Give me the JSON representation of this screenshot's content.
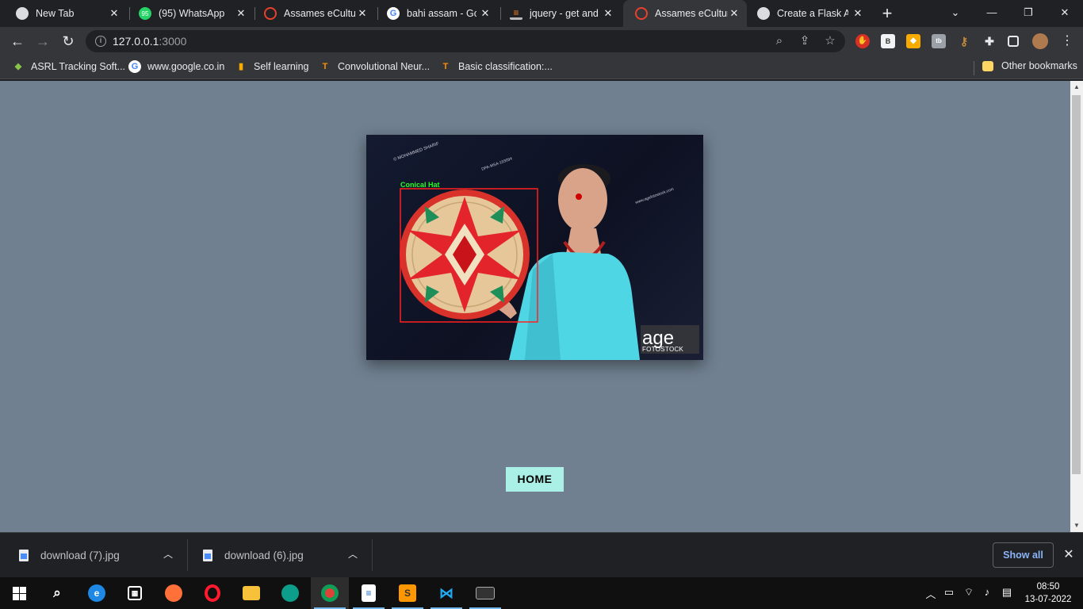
{
  "tabs": [
    {
      "title": "New Tab",
      "icon": "chrome-icon",
      "color": "#dadce0"
    },
    {
      "title": "(95) WhatsApp",
      "icon": "whatsapp-icon",
      "color": "#25d366",
      "badge": "95"
    },
    {
      "title": "Assames eCulture",
      "icon": "opera-icon",
      "color": "#e8412c"
    },
    {
      "title": "bahi assam - Google",
      "icon": "google-icon",
      "color": "#4285f4"
    },
    {
      "title": "jquery - get and l",
      "icon": "stackoverflow-icon",
      "color": "#f48024"
    },
    {
      "title": "Assames eCulture",
      "icon": "opera-icon",
      "color": "#e8412c"
    },
    {
      "title": "Create a Flask App",
      "icon": "flask-icon",
      "color": "#dadce0"
    }
  ],
  "active_tab": 5,
  "window": {
    "minimize": "—",
    "restore": "❐",
    "close": "✕",
    "newtab": "+",
    "tabsearch": "⌄"
  },
  "address": {
    "host": "127.0.0.1",
    "port": ":3000"
  },
  "bookmarks": [
    {
      "label": "ASRL Tracking Soft...",
      "icon": "asrl-icon",
      "color": "#8bc34a"
    },
    {
      "label": "www.google.co.in",
      "icon": "google-icon",
      "color": "#4285f4"
    },
    {
      "label": "Self learning",
      "icon": "analytics-icon",
      "color": "#f9ab00"
    },
    {
      "label": "Convolutional Neur...",
      "icon": "tensorflow-icon",
      "color": "#ff8f00"
    },
    {
      "label": "Basic classification:...",
      "icon": "tensorflow-icon",
      "color": "#ff8f00"
    }
  ],
  "other_bookmarks": "Other bookmarks",
  "photo": {
    "detection_label": "Conical Hat",
    "detection_color": "#ff2020",
    "label_color": "#22ff22",
    "watermark_brand": "age",
    "watermark_sub": "FOTOSTOCK",
    "watermark_credit": "© MOHAMMED SHARIF",
    "watermark_code": "DPA-MSA-193094",
    "watermark_site": "www.agefotostock.com"
  },
  "home_button": "HOME",
  "page_bg": "#708090",
  "button_bg": "#aaf0e6",
  "downloads": [
    {
      "name": "download (7).jpg"
    },
    {
      "name": "download (6).jpg"
    }
  ],
  "show_all": "Show all",
  "taskbar": {
    "apps": [
      "start-icon",
      "search-icon",
      "edge-icon",
      "store-icon",
      "firefox-icon",
      "opera-icon",
      "explorer-icon",
      "edge-dev-icon",
      "chrome-icon",
      "libreoffice-writer-icon",
      "sublime-icon",
      "vscode-icon",
      "terminal-icon"
    ],
    "time": "08:50",
    "date": "13-07-2022"
  }
}
